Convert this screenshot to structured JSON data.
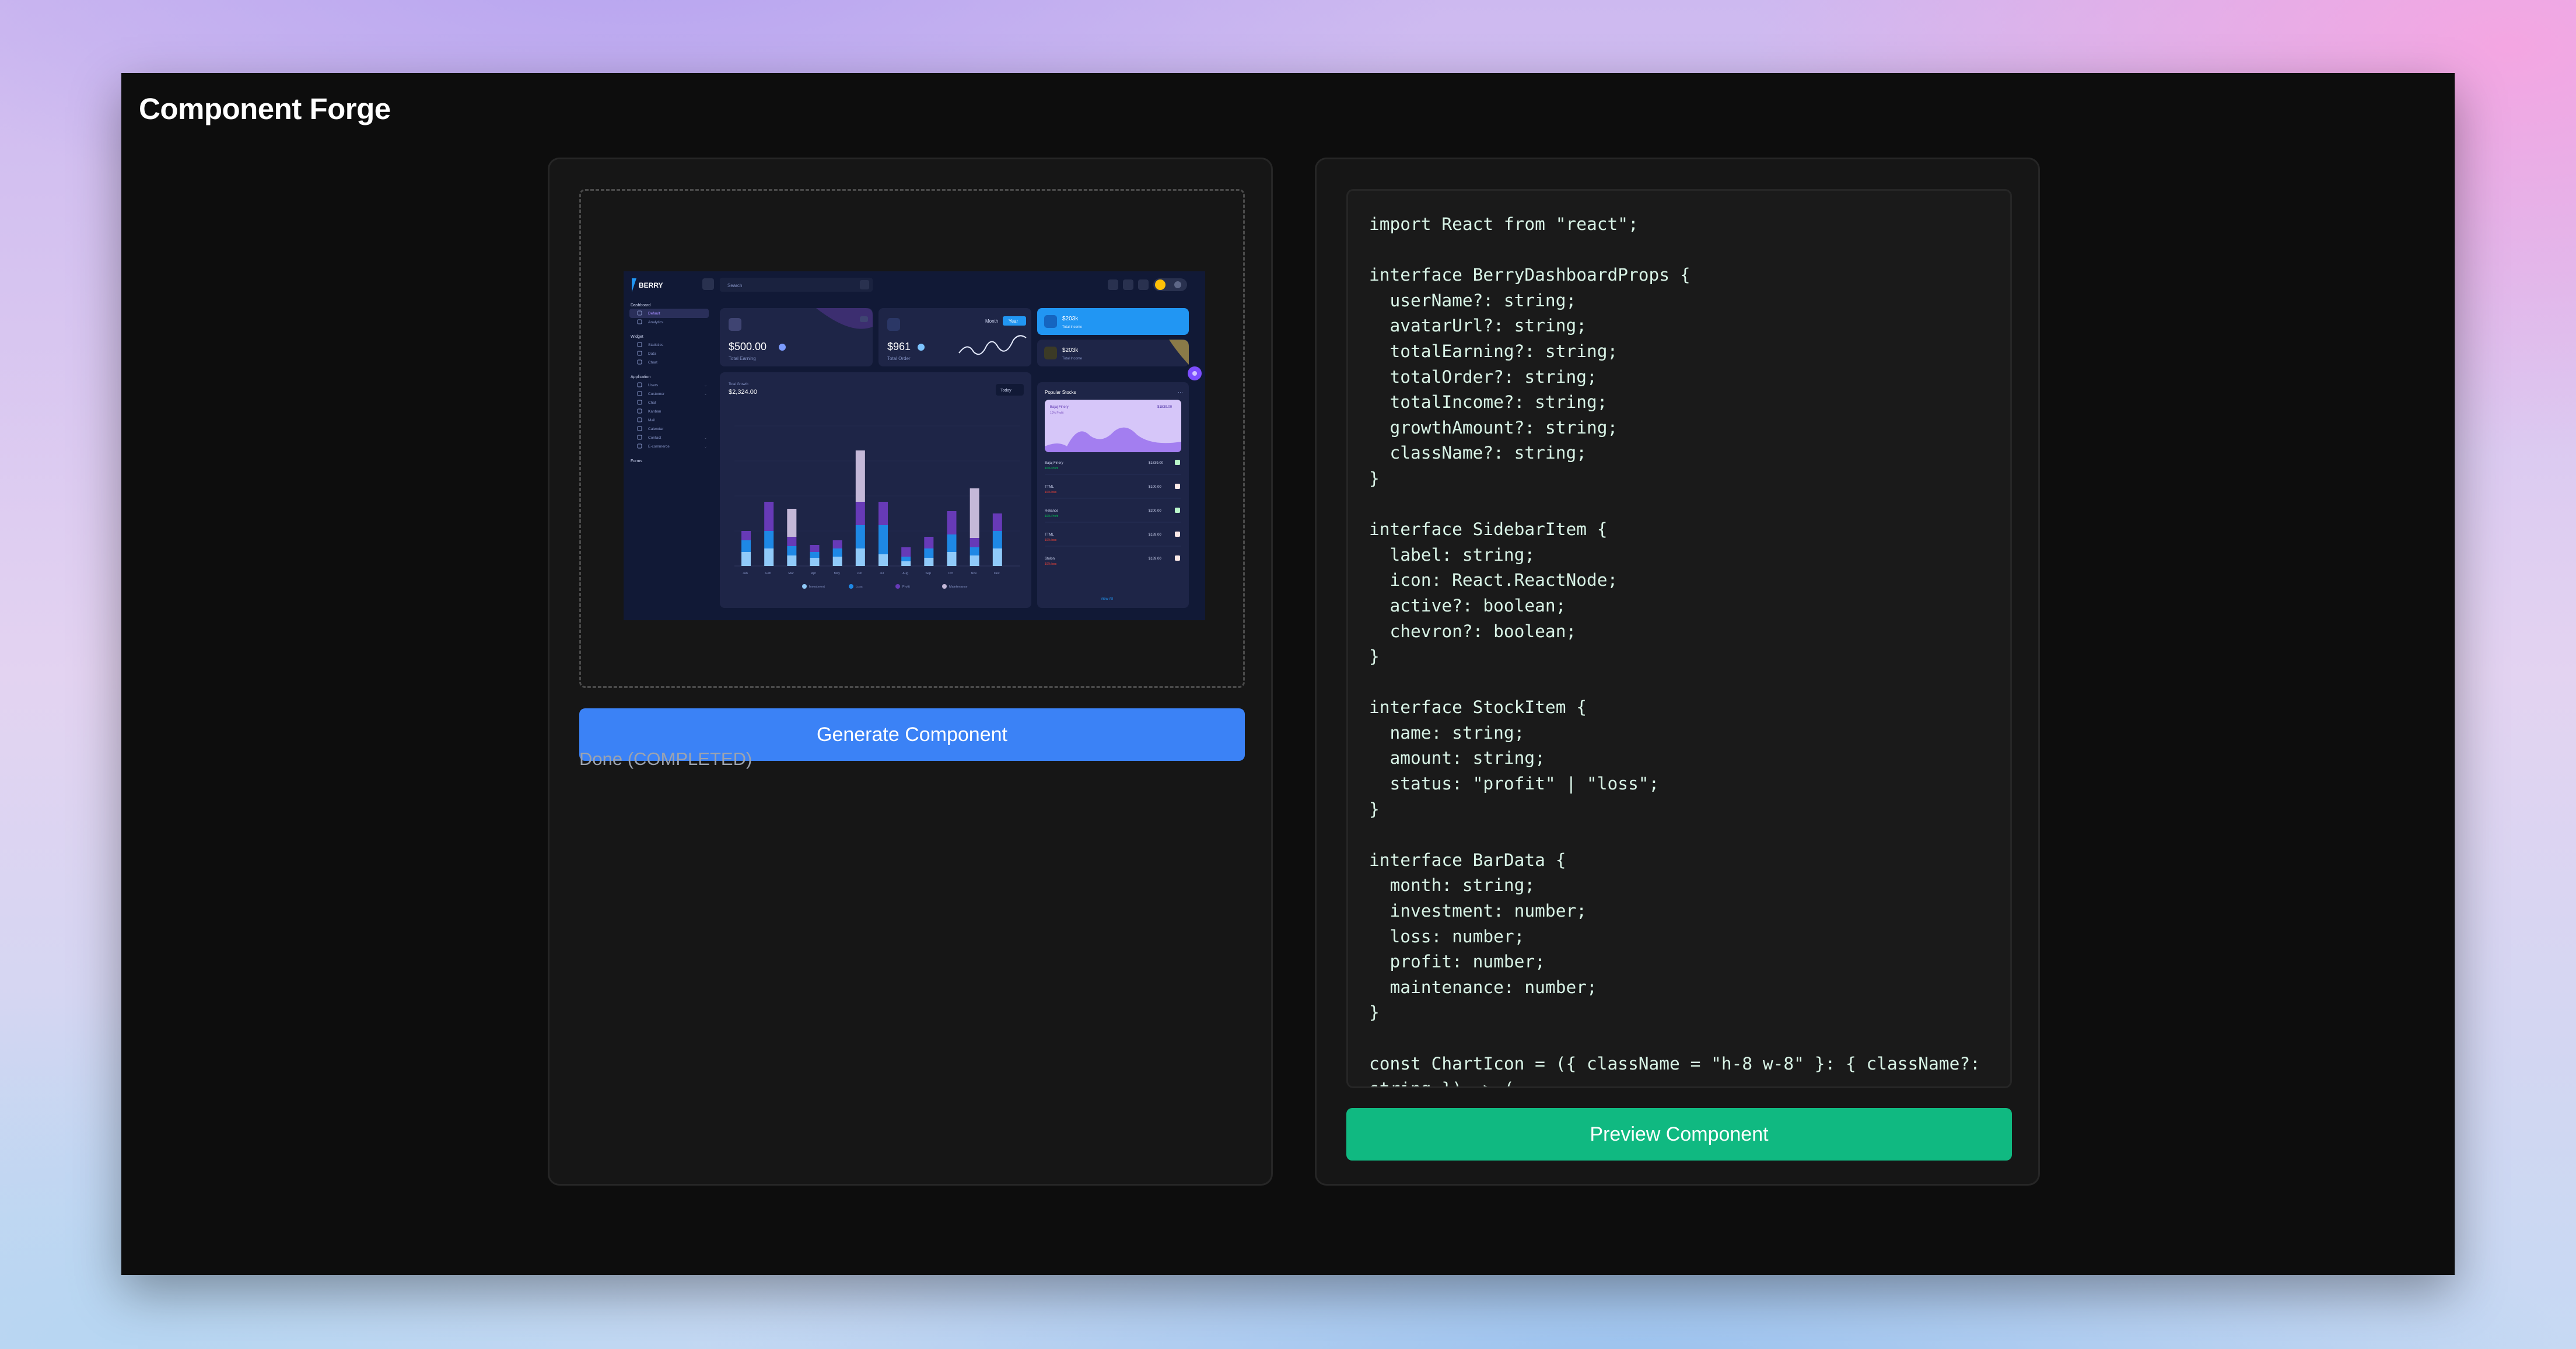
{
  "app": {
    "title": "Component Forge"
  },
  "upload": {
    "preview": {
      "brand": "BERRY",
      "search_placeholder": "Search",
      "sidebar": {
        "sections": [
          {
            "heading": "Dashboard",
            "items": [
              "Default",
              "Analytics"
            ]
          },
          {
            "heading": "Widget",
            "items": [
              "Statistics",
              "Data",
              "Chart"
            ]
          },
          {
            "heading": "Application",
            "items": [
              "Users",
              "Customer",
              "Chat",
              "Kanban",
              "Mail",
              "Calendar",
              "Contact",
              "E-commerce"
            ]
          },
          {
            "heading": "Forms",
            "items": []
          }
        ]
      },
      "cards": {
        "earning": {
          "value": "$500.00",
          "label": "Total Earning"
        },
        "order": {
          "value": "$961",
          "label": "Total Order",
          "toggle": [
            "Month",
            "Year"
          ]
        },
        "income_dark": {
          "value": "$203k",
          "label": "Total Income"
        },
        "income_light": {
          "value": "$203k",
          "label": "Total Income"
        }
      },
      "growth": {
        "label": "Total Growth",
        "value": "$2,324.00",
        "filter": "Today"
      },
      "popular": {
        "title": "Popular Stocks",
        "feature": {
          "name": "Bajaj Finery",
          "value": "$1839.00",
          "sub": "10% Profit"
        },
        "stocks": [
          {
            "name": "Bajaj Finery",
            "amount": "$1839.00",
            "status": "10% Profit"
          },
          {
            "name": "TTML",
            "amount": "$100.00",
            "status": "10% loss"
          },
          {
            "name": "Reliance",
            "amount": "$200.00",
            "status": "10% Profit"
          },
          {
            "name": "TTML",
            "amount": "$189.00",
            "status": "10% loss"
          },
          {
            "name": "Stolon",
            "amount": "$189.00",
            "status": "10% loss"
          }
        ],
        "view_all": "View All"
      },
      "chart_legend": [
        "Investment",
        "Loss",
        "Profit",
        "Maintenance"
      ],
      "months": [
        "Jan",
        "Feb",
        "Mar",
        "Apr",
        "May",
        "Jun",
        "Jul",
        "Aug",
        "Sep",
        "Oct",
        "Nov",
        "Dec"
      ]
    }
  },
  "actions": {
    "generate": "Generate Component",
    "status": "Done (COMPLETED)",
    "preview": "Preview Component"
  },
  "code": {
    "lines": [
      "import React from \"react\";",
      "",
      "interface BerryDashboardProps {",
      "  userName?: string;",
      "  avatarUrl?: string;",
      "  totalEarning?: string;",
      "  totalOrder?: string;",
      "  totalIncome?: string;",
      "  growthAmount?: string;",
      "  className?: string;",
      "}",
      "",
      "interface SidebarItem {",
      "  label: string;",
      "  icon: React.ReactNode;",
      "  active?: boolean;",
      "  chevron?: boolean;",
      "}",
      "",
      "interface StockItem {",
      "  name: string;",
      "  amount: string;",
      "  status: \"profit\" | \"loss\";",
      "}",
      "",
      "interface BarData {",
      "  month: string;",
      "  investment: number;",
      "  loss: number;",
      "  profit: number;",
      "  maintenance: number;",
      "}",
      "",
      "const ChartIcon = ({ className = \"h-8 w-8\" }: { className?:",
      "string }) => ("
    ]
  },
  "colors": {
    "generate_button": "#3b82f6",
    "preview_button": "#10b981",
    "window_bg": "#0d0d0d",
    "panel_bg": "#161616"
  }
}
